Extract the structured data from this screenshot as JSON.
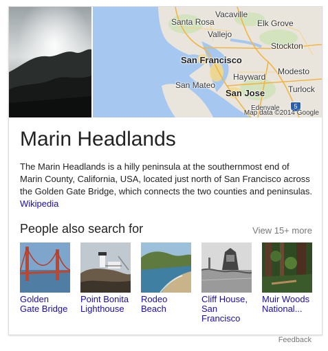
{
  "map": {
    "places": {
      "vacaville": "Vacaville",
      "santa_rosa": "Santa Rosa",
      "elk_grove": "Elk Grove",
      "vallejo": "Vallejo",
      "stockton": "Stockton",
      "san_francisco": "San Francisco",
      "hayward": "Hayward",
      "modesto": "Modesto",
      "san_mateo": "San Mateo",
      "turlock": "Turlock",
      "san_jose": "San Jose",
      "edenvale": "Edenvale"
    },
    "highway_shield": "5",
    "credit": "Map data ©2014 Google"
  },
  "entity": {
    "title": "Marin Headlands",
    "description": "The Marin Headlands is a hilly peninsula at the southernmost end of Marin County, California, USA, located just north of San Francisco across the Golden Gate Bridge, which connects the two counties and peninsulas.",
    "source_link": "Wikipedia"
  },
  "people_also_search": {
    "heading": "People also search for",
    "view_more": "View 15+ more",
    "items": [
      {
        "label": "Golden Gate Bridge"
      },
      {
        "label": "Point Bonita Lighthouse"
      },
      {
        "label": "Rodeo Beach"
      },
      {
        "label": "Cliff House, San Francisco"
      },
      {
        "label": "Muir Woods National..."
      }
    ]
  },
  "footer": {
    "feedback": "Feedback"
  }
}
